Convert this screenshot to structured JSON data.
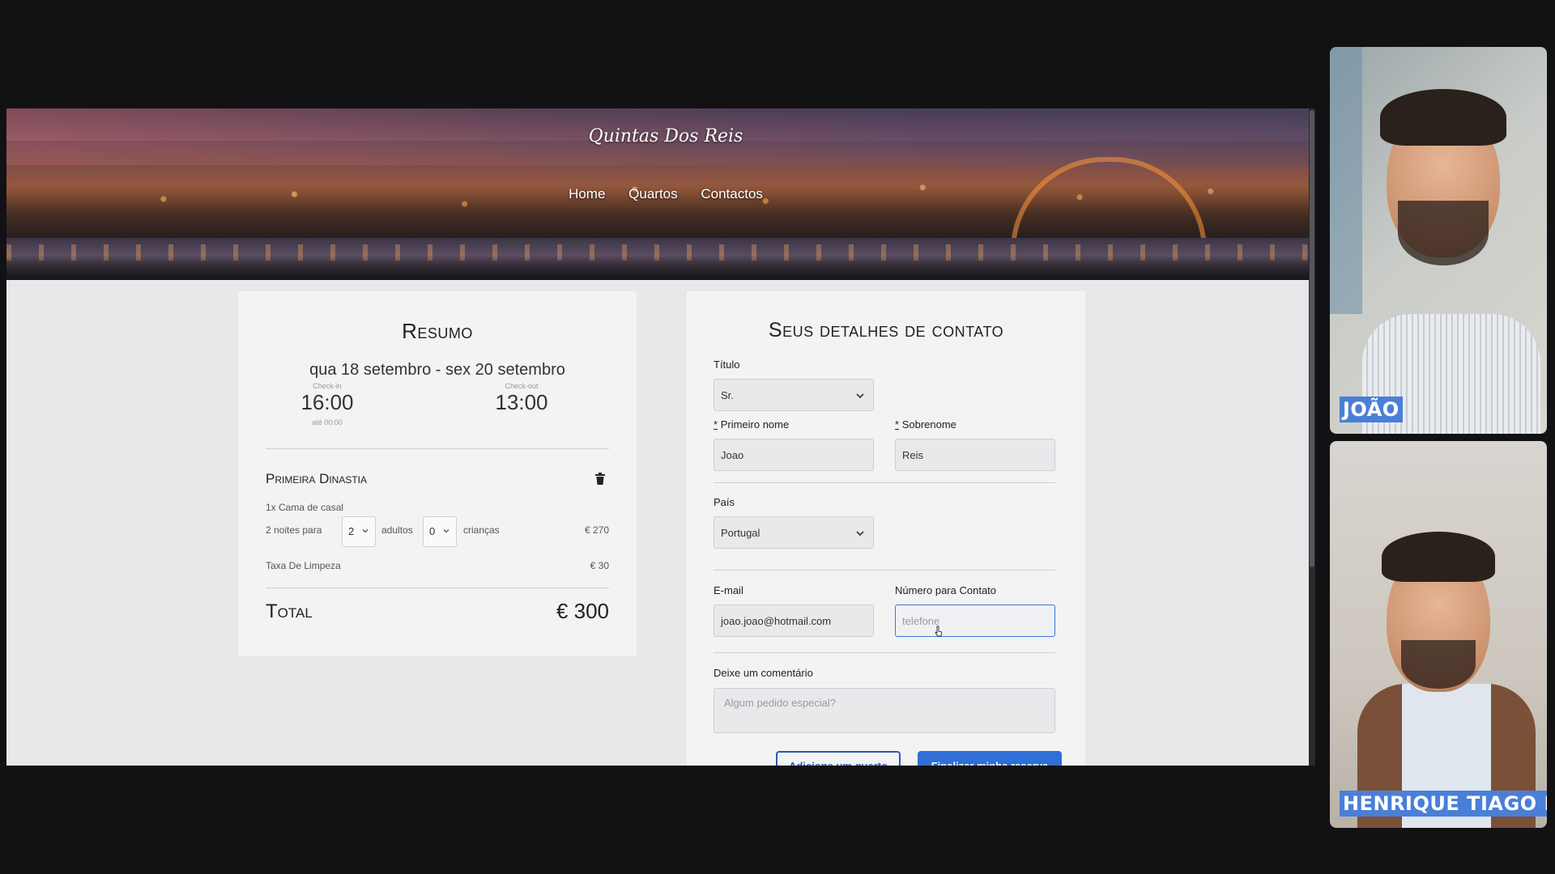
{
  "site": {
    "logo": "Quintas Dos Reis",
    "nav": [
      "Home",
      "Quartos",
      "Contactos"
    ]
  },
  "summary": {
    "title": "Resumo",
    "dates": "qua 18 setembro - sex 20 setembro",
    "checkin_label": "Check-in",
    "checkin_time": "16:00",
    "checkin_until": "até 00:00",
    "checkout_label": "Check-out",
    "checkout_time": "13:00",
    "room_name": "Primeira Dinastia",
    "bed": "1x Cama de casal",
    "nights_text": "2 noites para",
    "adults_value": "2",
    "adults_label": "adultos",
    "children_value": "0",
    "children_label": "crianças",
    "room_price": "€ 270",
    "fee_label": "Taxa De Limpeza",
    "fee_price": "€ 30",
    "total_label": "Total",
    "total_value": "€ 300"
  },
  "contact": {
    "title": "Seus detalhes de contato",
    "title_label": "Título",
    "title_value": "Sr.",
    "first_name_label": "Primeiro nome",
    "first_name_value": "Joao",
    "last_name_label": "Sobrenome",
    "last_name_value": "Reis",
    "country_label": "País",
    "country_value": "Portugal",
    "email_label": "E-mail",
    "email_value": "joao.joao@hotmail.com",
    "phone_label": "Número para Contato",
    "phone_placeholder": "telefone",
    "comment_label": "Deixe um comentário",
    "comment_placeholder": "Algum pedido especial?",
    "required_mark": "*",
    "add_room_button": "Adicione um quarto",
    "finish_button": "Finalizar minha reserva"
  },
  "participants": [
    {
      "name": "JOÃO"
    },
    {
      "name": "HENRIQUE TIAGO I"
    }
  ],
  "colors": {
    "accent": "#2f6fd6",
    "name_tag": "#4a7fd8",
    "page_bg": "#e8e8ea"
  }
}
